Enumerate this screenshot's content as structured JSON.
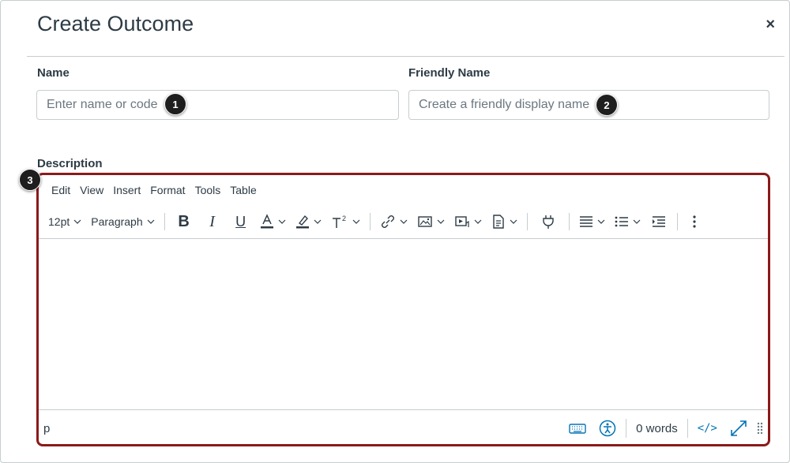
{
  "dialog": {
    "title": "Create Outcome",
    "close_label": "×"
  },
  "name_field": {
    "label": "Name",
    "placeholder": "Enter name or code",
    "value": ""
  },
  "friendly_name_field": {
    "label": "Friendly Name",
    "placeholder": "Create a friendly display name",
    "value": ""
  },
  "description": {
    "label": "Description"
  },
  "editor": {
    "menu": [
      "Edit",
      "View",
      "Insert",
      "Format",
      "Tools",
      "Table"
    ],
    "font_size": "12pt",
    "block_format": "Paragraph",
    "toolbar_icons": [
      "bold-icon",
      "italic-icon",
      "underline-icon",
      "text-color-icon",
      "highlight-color-icon",
      "superscript-icon",
      "link-icon",
      "image-icon",
      "media-icon",
      "document-icon",
      "plugin-icon",
      "align-icon",
      "list-icon",
      "indent-icon",
      "more-icon"
    ],
    "content": "",
    "status_path": "p",
    "word_count": "0 words",
    "html_toggle_label": "</>",
    "accent_color": "#0374b5"
  },
  "callouts": [
    "1",
    "2",
    "3"
  ],
  "colors": {
    "highlight_border": "#8b1a1a",
    "text": "#2d3b45",
    "border": "#c7cdd1"
  }
}
